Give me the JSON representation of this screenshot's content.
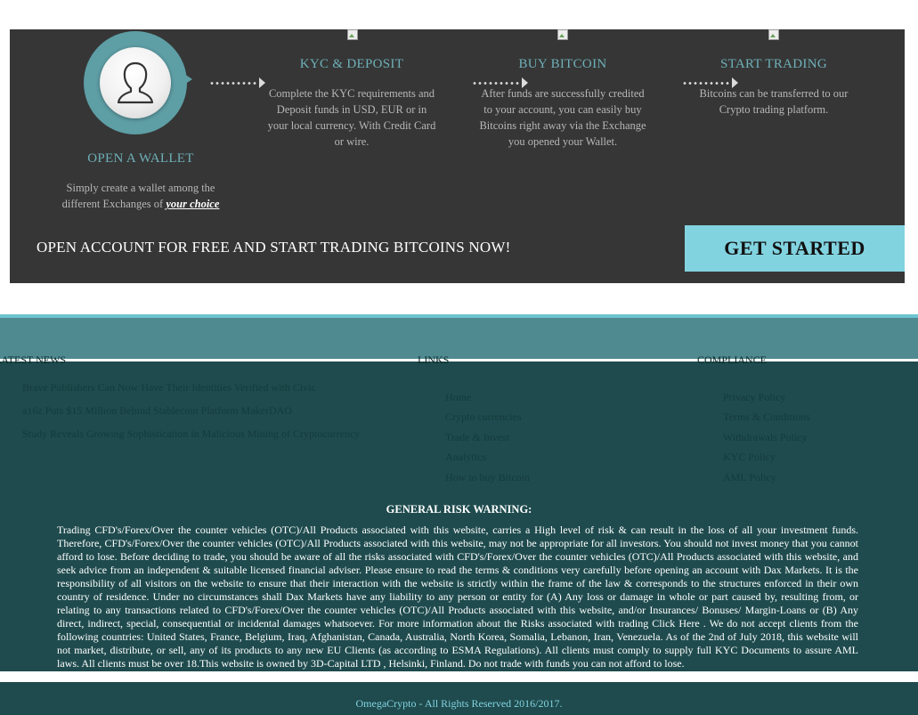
{
  "steps": [
    {
      "title": "OPEN A WALLET",
      "desc": "Simply create a wallet among the different Exchanges of",
      "link": "your choice",
      "icon": "user-avatar-icon"
    },
    {
      "title": "KYC & DEPOSIT",
      "desc": "Complete the KYC requirements and Deposit funds in USD, EUR or in your local currency. With Credit Card or wire.",
      "icon": "broken-image-icon"
    },
    {
      "title": "BUY BITCOIN",
      "desc": "After funds are successfully credited to your account, you can easily buy Bitcoins right away via the Exchange you opened your Wallet.",
      "icon": "broken-image-icon"
    },
    {
      "title": "START TRADING",
      "desc": "Bitcoins can be transferred to our Crypto trading platform.",
      "icon": "broken-image-icon"
    }
  ],
  "cta": {
    "text": "OPEN ACCOUNT FOR FREE AND START TRADING BITCOINS NOW!",
    "button": "GET STARTED"
  },
  "footer": {
    "news": {
      "heading": "LATEST NEWS",
      "items": [
        "Brave Publishers Can Now Have Their Identities Verified with Civic",
        "a16z Puts $15 Million Behind Stablecoin Platform MakerDAO",
        "Study Reveals Growing Sophistication in Malicious Mining of Cryptocurrency"
      ]
    },
    "links": {
      "heading": "LINKS",
      "items": [
        "Home",
        "Crypto currencies",
        "Trade & Invest",
        "Analytics",
        "How to buy Bitcoin"
      ]
    },
    "compliance": {
      "heading": "COMPLIANCE",
      "items": [
        "Privacy Policy",
        "Terms & Conditions",
        "Withdrawals Policy",
        "KYC Policy",
        "AML Policy"
      ]
    }
  },
  "risk": {
    "title": "GENERAL RISK WARNING:",
    "text": "Trading CFD's/Forex/Over the counter vehicles (OTC)/All Products associated with this website, carries a High level of risk & can result in the loss of all your investment funds. Therefore, CFD's/Forex/Over the counter vehicles (OTC)/All Products associated with this website, may not be appropriate for all investors. You should not invest money that you cannot afford to lose. Before deciding to trade, you should be aware of all the risks associated with CFD's/Forex/Over the counter vehicles (OTC)/All Products associated with this website, and seek advice from an independent & suitable licensed financial adviser. Please ensure to read the terms & conditions very carefully before opening an account with Dax Markets. It is the responsibility of all visitors on the website to ensure that their interaction with the website is strictly within the frame of the law & corresponds to the structures enforced in their own country of residence. Under no circumstances shall Dax Markets have any liability to any person or entity for (A) Any loss or damage in whole or part caused by, resulting from, or relating to any transactions related to CFD's/Forex/Over the counter vehicles (OTC)/All Products associated with this website, and/or Insurances/ Bonuses/ Margin-Loans or (B) Any direct, indirect, special, consequential or incidental damages whatsoever. For more information about the Risks associated with trading Click Here . We do not accept clients from the following countries: United States, France, Belgium, Iraq, Afghanistan, Canada, Australia, North Korea, Somalia, Lebanon, Iran, Venezuela. As of the 2nd of July 2018, this website will not market, distribute, or sell, any of its products to any new EU Clients (as according to ESMA Regulations). All clients must comply to supply full KYC Documents to assure AML laws. All clients must be over 18.This website is owned by 3D-Capital LTD , Helsinki, Finland. Do not trade with funds you can not afford to lose."
  },
  "copyright": "OmegaCrypto - All Rights Reserved 2016/2017.",
  "colors": {
    "banner_bg": "#363636",
    "accent_teal": "#5e9ea5",
    "cta_button": "#82d3e0",
    "footer_band": "#4f8a90",
    "footer_dark": "#1f4b4e"
  }
}
